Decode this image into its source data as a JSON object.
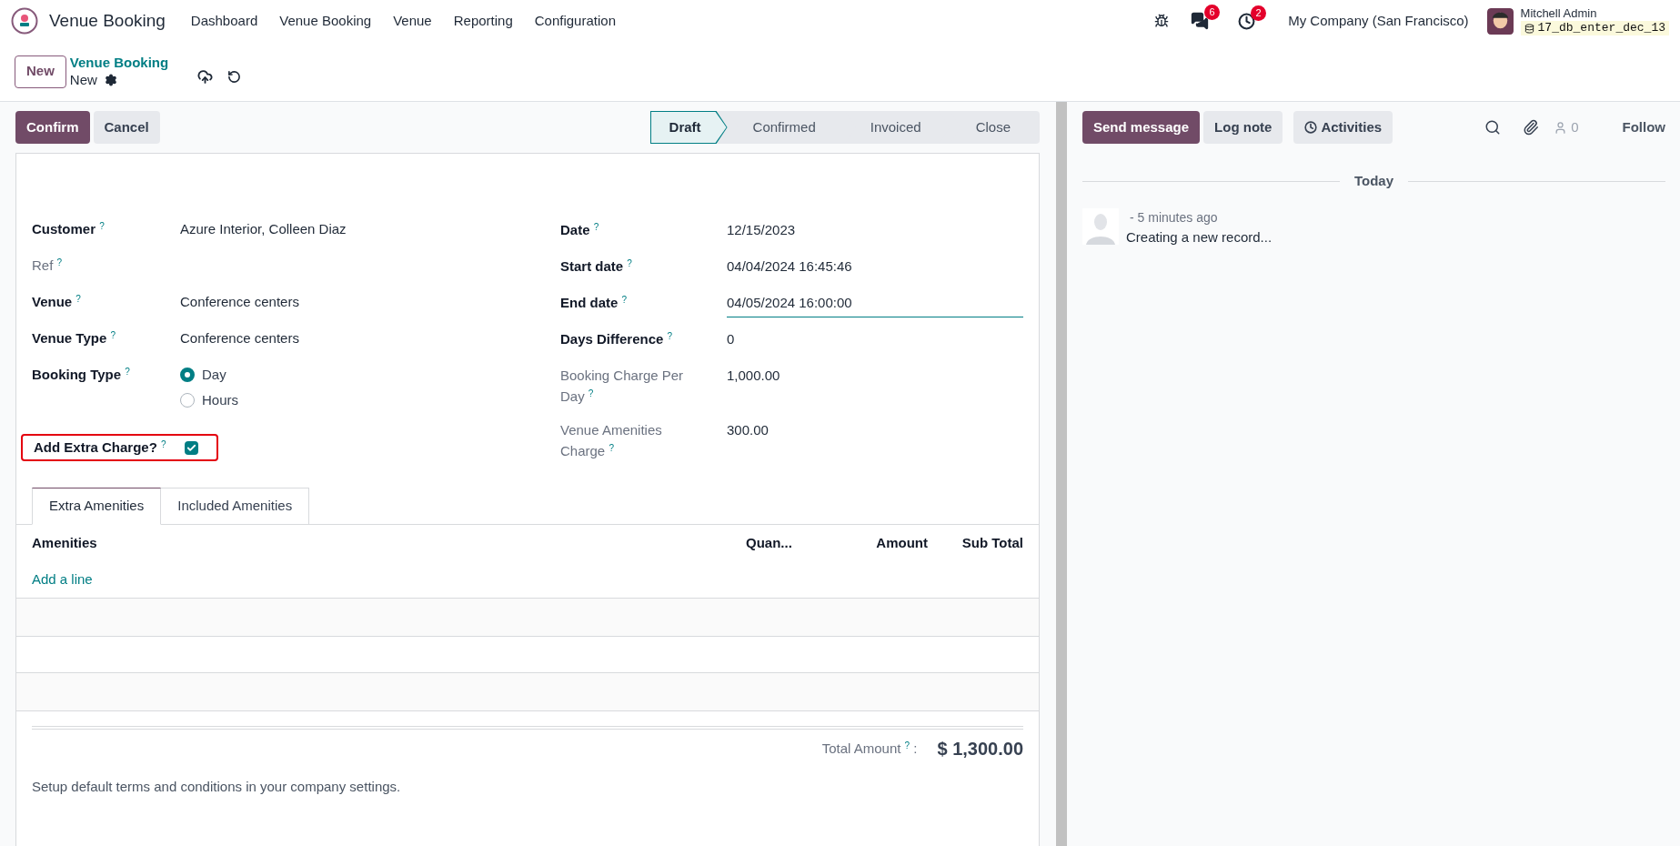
{
  "navbar": {
    "app_name": "Venue Booking",
    "menus": [
      "Dashboard",
      "Venue Booking",
      "Venue",
      "Reporting",
      "Configuration"
    ],
    "messages_badge": "6",
    "activities_badge": "2",
    "company": "My Company (San Francisco)",
    "user_name": "Mitchell Admin",
    "database": "17_db_enter_dec_13"
  },
  "control_panel": {
    "new_button": "New",
    "breadcrumb": "Venue Booking",
    "record_name": "New"
  },
  "action_buttons": [
    {
      "label": "Confirm",
      "kind": "primary"
    },
    {
      "label": "Cancel",
      "kind": "secondary"
    }
  ],
  "status_stages": [
    {
      "label": "Draft",
      "selected": true
    },
    {
      "label": "Confirmed",
      "selected": false
    },
    {
      "label": "Invoiced",
      "selected": false
    },
    {
      "label": "Close",
      "selected": false
    }
  ],
  "left_fields": [
    {
      "label": "Customer $^{?}$",
      "kind": "text",
      "readonly": false,
      "value": "Azure Interior, Colleen Diaz"
    },
    {
      "label": "Ref $^{?}$",
      "kind": "text",
      "readonly": true
    },
    {
      "label": "Venue $^{?}$",
      "kind": "text",
      "readonly": false,
      "value": "Conference centers"
    },
    {
      "label": "Venue Type $^{?}$",
      "kind": "text",
      "readonly": false,
      "value": "Conference centers"
    },
    {
      "label": "Booking Type $^{?}$",
      "kind": "radio",
      "readonly": false,
      "options": [
        {
          "label": "Day",
          "selected": true
        },
        {
          "label": "Hours",
          "selected": false
        }
      ]
    },
    {
      "label": "Add Extra Charge? $^{?}$",
      "kind": "checkbox",
      "checked": true,
      "highlighted": true
    }
  ],
  "right_fields": [
    {
      "label": "Date $^{?}$",
      "readonly": false,
      "focused": false,
      "value": "12/15/2023"
    },
    {
      "label": "Start date $^{?}$",
      "readonly": false,
      "focused": false,
      "value": "04/04/2024 16:45:46"
    },
    {
      "label": "End date $^{?}$",
      "readonly": false,
      "focused": true,
      "value": "04/05/2024 16:00:00"
    },
    {
      "label": "Days Difference $^{?}$",
      "readonly": false,
      "focused": false,
      "value": "0"
    },
    {
      "label": "Booking Charge Per Day $^{?}$",
      "readonly": true,
      "focused": false,
      "value": "1,000.00"
    },
    {
      "label": "Venue Amenities Charge $^{?}$",
      "readonly": true,
      "focused": false,
      "value": "300.00"
    }
  ],
  "tabs": [
    {
      "label": "Extra Amenities",
      "selected": true
    },
    {
      "label": "Included Amenities",
      "selected": false
    }
  ],
  "table": {
    "columns": [
      "Amenities",
      "Quan...",
      "Amount",
      "Sub Total"
    ],
    "add_line": "Add a line"
  },
  "total": {
    "label": "Total Amount $^{?}$ :",
    "value": "$ 1,300.00"
  },
  "terms_note": "Setup default terms and conditions in your company settings.",
  "chatter": {
    "buttons": [
      {
        "label": "Send message",
        "kind": "primary"
      },
      {
        "label": "Log note",
        "kind": "secondary"
      },
      {
        "label": "Activities",
        "kind": "activities"
      }
    ],
    "followers_count": "0",
    "follow": "Follow",
    "date_separator": "Today",
    "messages": [
      {
        "time": "- 5 minutes ago",
        "body": "Creating a new record..."
      }
    ]
  }
}
